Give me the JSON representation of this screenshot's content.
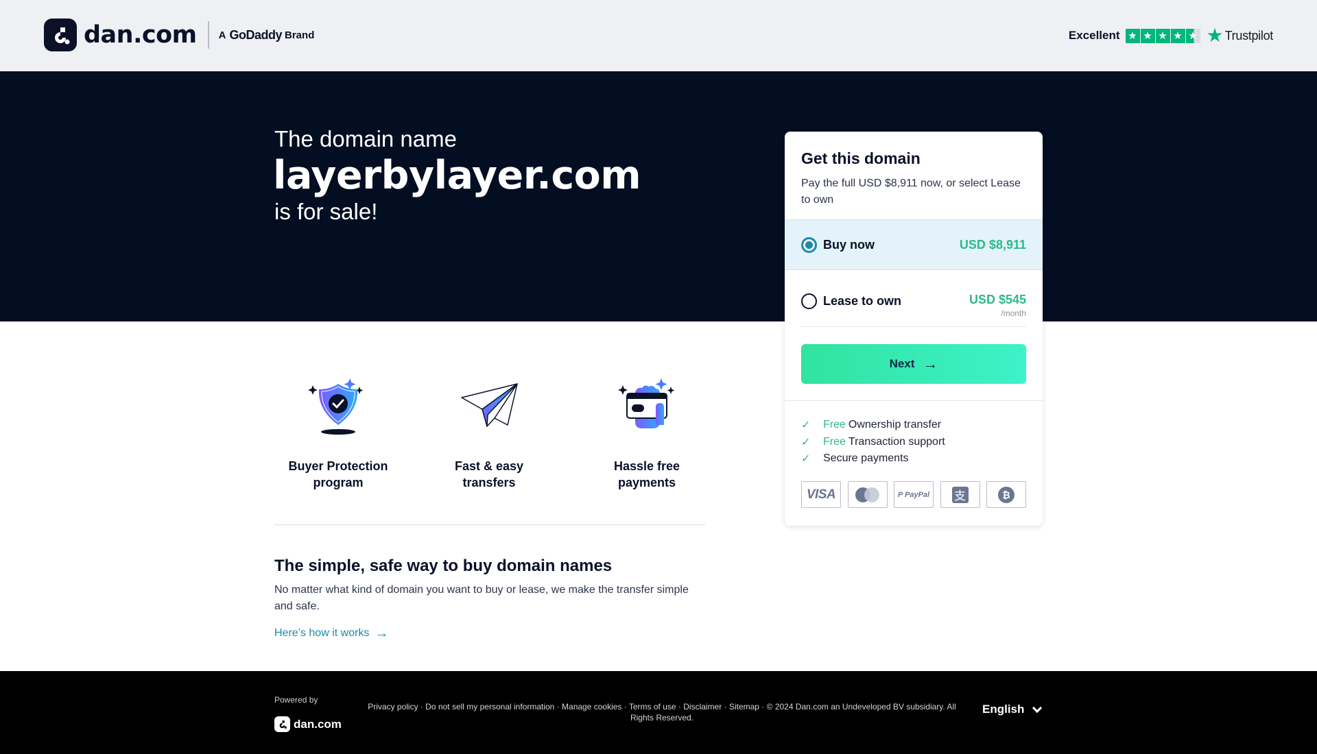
{
  "header": {
    "logo_text": "dan.com",
    "brand_prefix": "A",
    "brand_name": "GoDaddy",
    "brand_suffix": "Brand",
    "trustpilot": {
      "rating_label": "Excellent",
      "stars": 4.5,
      "star_glyph": "★",
      "logo_text": "Trustpilot",
      "brand_color": "#00b67a"
    }
  },
  "hero": {
    "pre": "The domain name",
    "domain": "layerbylayer.com",
    "post": "is for sale!"
  },
  "card": {
    "title": "Get this domain",
    "subtitle": "Pay the full USD $8,911 now, or select Lease to own",
    "options": [
      {
        "label": "Buy now",
        "price": "USD $8,911",
        "unit": "",
        "selected": true
      },
      {
        "label": "Lease to own",
        "price": "USD $545",
        "unit": "/month",
        "selected": false
      }
    ],
    "next_label": "Next",
    "next_arrow": "→",
    "benefits": [
      {
        "free": "Free",
        "text": "Ownership transfer"
      },
      {
        "free": "Free",
        "text": "Transaction support"
      },
      {
        "free": "",
        "text": "Secure payments"
      }
    ],
    "check_glyph": "✓",
    "payment_methods": [
      {
        "name": "visa-icon",
        "label": "VISA"
      },
      {
        "name": "mastercard-icon",
        "label": ""
      },
      {
        "name": "paypal-icon",
        "label": "P PayPal"
      },
      {
        "name": "alipay-icon",
        "label": "支"
      },
      {
        "name": "bitcoin-icon",
        "label": "₿"
      }
    ],
    "accent_color": "#2fb88a",
    "selected_color": "#1e89a8"
  },
  "features": [
    {
      "icon": "shield-check-icon",
      "label": "Buyer Protection program"
    },
    {
      "icon": "paper-plane-icon",
      "label": "Fast & easy transfers"
    },
    {
      "icon": "card-payment-icon",
      "label": "Hassle free payments"
    }
  ],
  "info": {
    "title": "The simple, safe way to buy domain names",
    "text": "No matter what kind of domain you want to buy or lease, we make the transfer simple and safe.",
    "link_label": "Here’s how it works",
    "link_arrow": "→"
  },
  "footer": {
    "powered_by": "Powered by",
    "logo_text": "dan.com",
    "links": [
      "Privacy policy",
      "Do not sell my personal information",
      "Manage cookies",
      "Terms of use",
      "Disclaimer",
      "Sitemap"
    ],
    "separator": " · ",
    "copyright": "© 2024 Dan.com an Undeveloped BV subsidiary. All Rights Reserved.",
    "language": "English"
  }
}
